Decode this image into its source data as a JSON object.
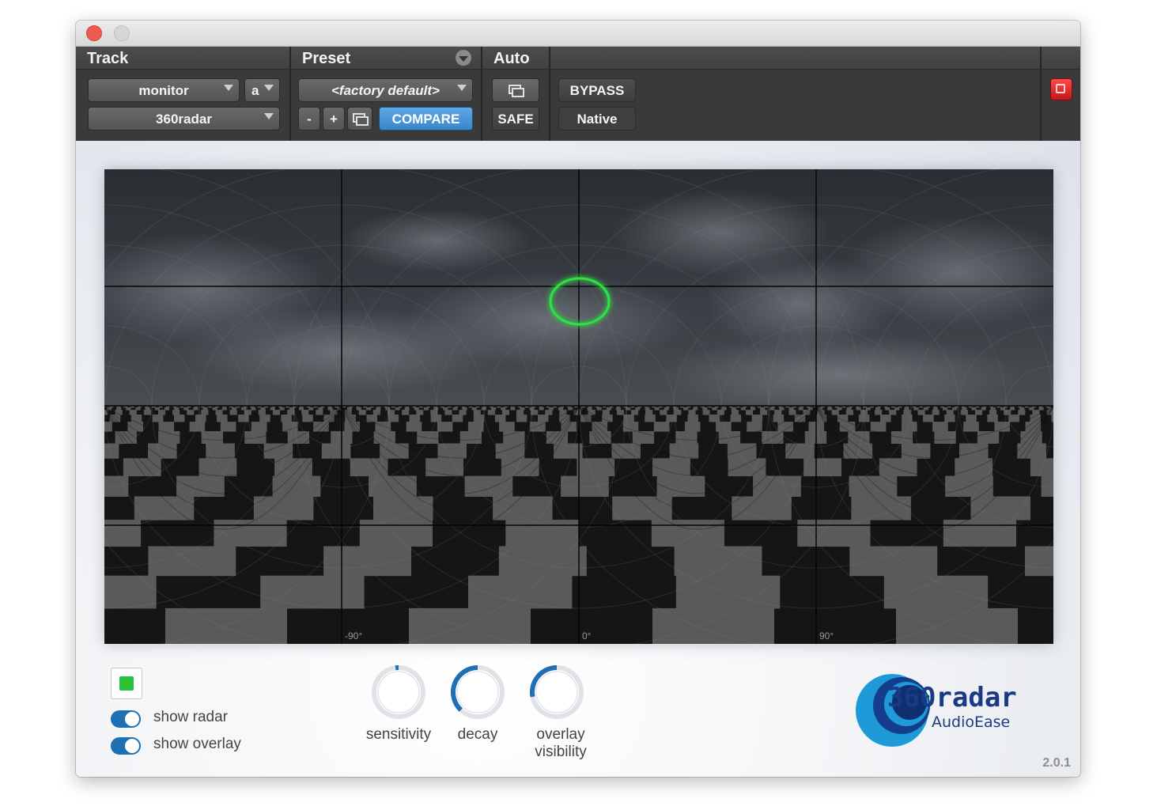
{
  "header": {
    "track": {
      "label": "Track",
      "track_name": "monitor",
      "channel": "a",
      "plugin": "360radar"
    },
    "preset": {
      "label": "Preset",
      "value": "<factory default>",
      "minus": "-",
      "plus": "+",
      "compare": "COMPARE"
    },
    "auto": {
      "label": "Auto",
      "safe": "SAFE"
    },
    "bypass": "BYPASS",
    "native": "Native"
  },
  "view": {
    "degree_labels": [
      "-90°",
      "0°",
      "90°"
    ]
  },
  "controls": {
    "show_radar": {
      "label": "show radar",
      "on": true
    },
    "show_overlay": {
      "label": "show overlay",
      "on": true
    },
    "knobs": [
      {
        "label": "sensitivity",
        "value": 0.02
      },
      {
        "label": "decay",
        "value": 0.38
      },
      {
        "label": "overlay visibility",
        "value": 0.28
      }
    ]
  },
  "brand": {
    "logo_text": "360radar",
    "maker": "AudioEase",
    "version": "2.0.1"
  },
  "colors": {
    "accent_blue": "#1f6fb4",
    "radar_green": "#27c23a",
    "power_red": "#e02424"
  }
}
